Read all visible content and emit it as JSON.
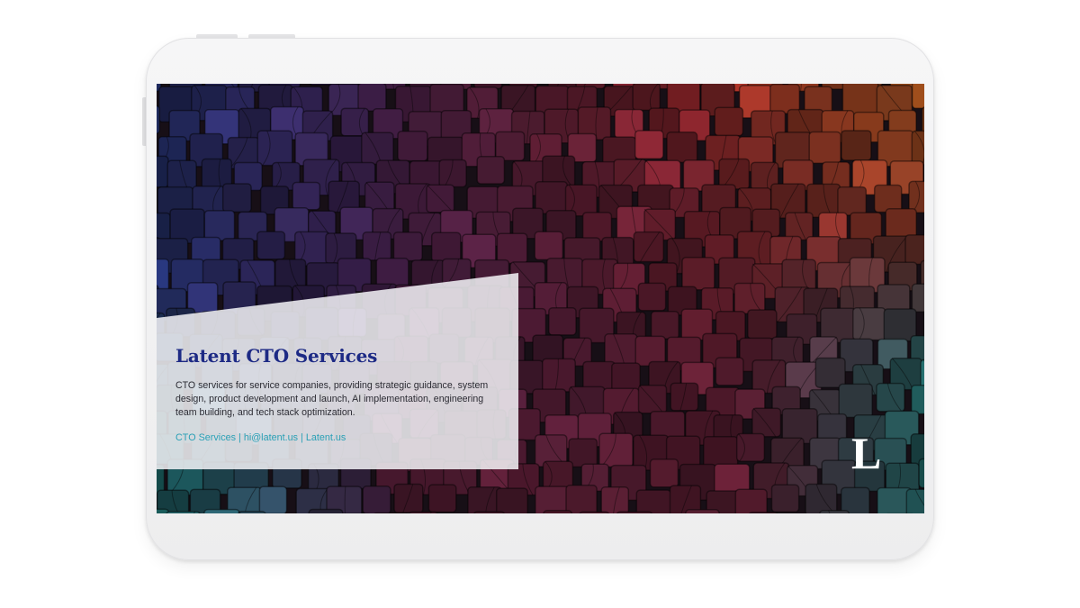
{
  "card": {
    "title": "Latent CTO Services",
    "description": "CTO services for service companies, providing strategic guidance, system design, product development and launch, AI implementation, engineering team building, and tech stack optimization.",
    "links": [
      {
        "label": "CTO Services"
      },
      {
        "label": "hi@latent.us"
      },
      {
        "label": "Latent.us"
      }
    ],
    "separator": "|"
  },
  "logo": {
    "letter": "L"
  },
  "colors": {
    "title": "#1d2a85",
    "link": "#2aa0b6",
    "text": "#2b2b33",
    "device_frame": "#efeff0"
  },
  "background": {
    "description_icon": "abstract-cubes-pattern"
  }
}
